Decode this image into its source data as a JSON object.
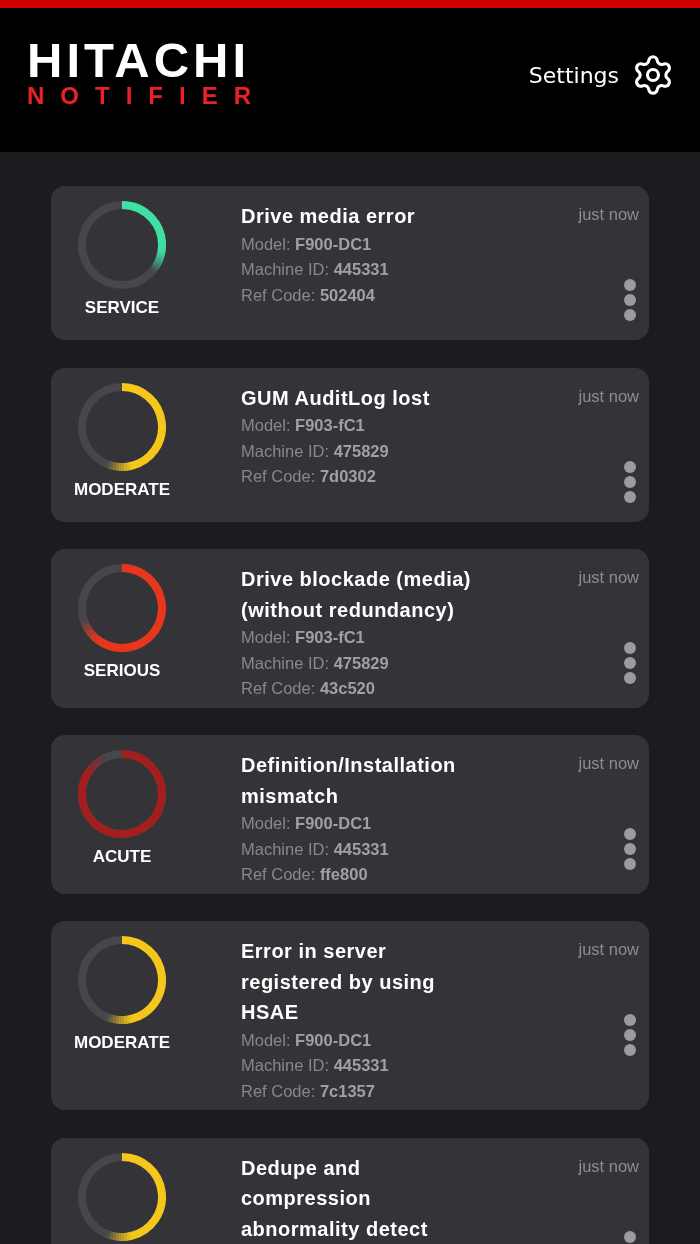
{
  "header": {
    "logo": "HITACHI",
    "subtitle": "NOTIFIER",
    "settings": "Settings"
  },
  "alerts": [
    {
      "kind": "service",
      "severity": "SERVICE",
      "color": "#3ee0a3",
      "title": "Drive media error",
      "time": "just now",
      "details": [
        "Model: **F900-DC1**",
        "Machine ID: **445331**",
        "Ref Code: **502404**"
      ]
    },
    {
      "kind": "moderate",
      "severity": "MODERATE",
      "color": "#f5c71a",
      "title": "GUM AuditLog lost",
      "time": "just now",
      "details": [
        "Model: **F903-fC1**",
        "Machine ID: **475829**",
        "Ref Code: **7d0302**"
      ]
    },
    {
      "kind": "serious",
      "severity": "SERIOUS",
      "color": "#e8361b",
      "title": "Drive blockade (media) (without redundancy)",
      "time": "just now",
      "details": [
        "Model: **F903-fC1**",
        "Machine ID: **475829**",
        "Ref Code: **43c520**"
      ]
    },
    {
      "kind": "acute",
      "severity": "ACUTE",
      "color": "#a31f1f",
      "title": "Definition/Installation mismatch",
      "time": "just now",
      "details": [
        "Model: **F900-DC1**",
        "Machine ID: **445331**",
        "Ref Code: **ffe800**"
      ]
    },
    {
      "kind": "moderate",
      "severity": "MODERATE",
      "color": "#f5c71a",
      "title": "Error in server registered by using HSAE",
      "time": "just now",
      "details": [
        "Model: **F900-DC1**",
        "Machine ID: **445331**",
        "Ref Code: **7c1357**"
      ]
    },
    {
      "kind": "moderate",
      "color": "#f5c71a",
      "title": "Dedupe and compression abnormality detect",
      "time": "just now"
    }
  ]
}
